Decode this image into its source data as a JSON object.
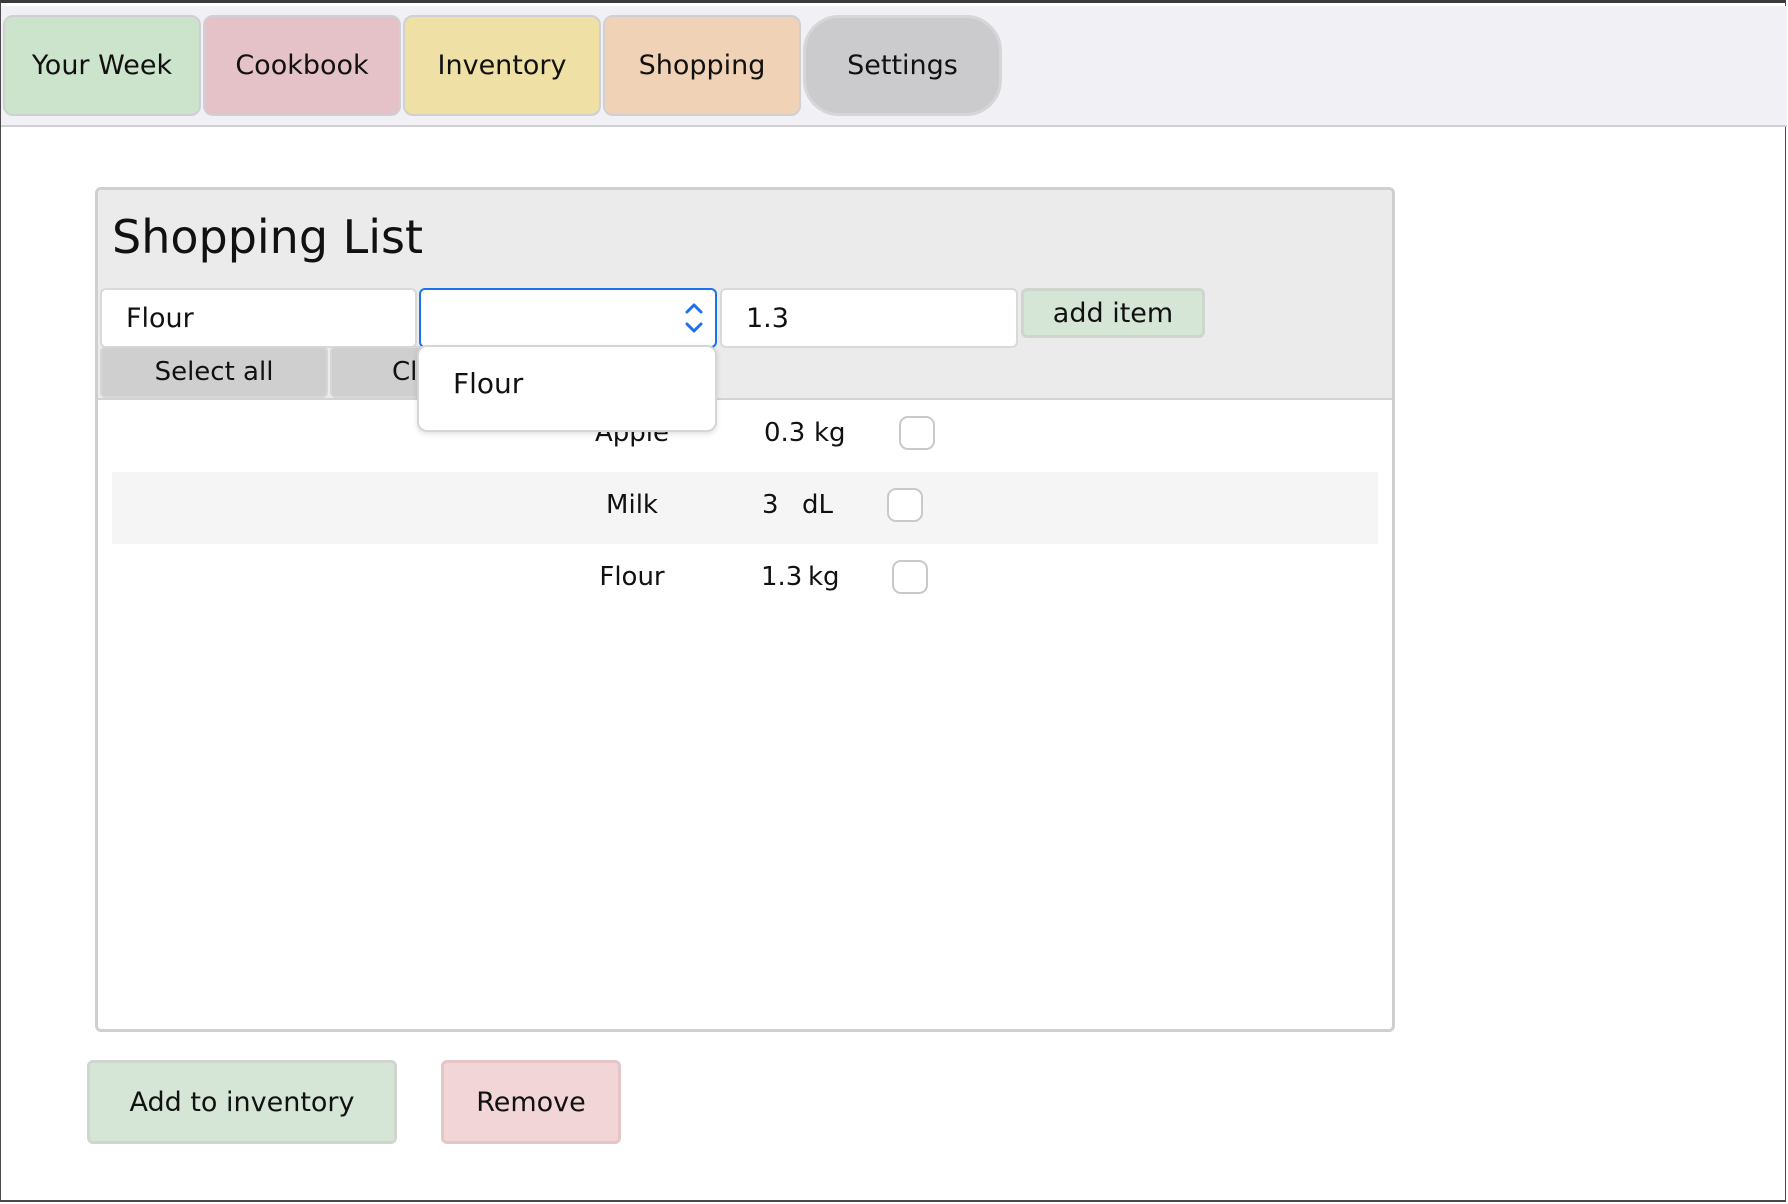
{
  "nav": {
    "tabs": [
      {
        "label": "Your Week",
        "color": "#cce3cc"
      },
      {
        "label": "Cookbook",
        "color": "#e4c2c8"
      },
      {
        "label": "Inventory",
        "color": "#efe0a6"
      },
      {
        "label": "Shopping",
        "color": "#f0d3b7"
      },
      {
        "label": "Settings",
        "color": "#cbcbcd"
      }
    ]
  },
  "shopping": {
    "title": "Shopping List",
    "form": {
      "name_value": "Flour",
      "unit_value": "",
      "quantity_value": "1.3",
      "add_item_label": "add item",
      "unit_options_visible": [
        "Flour"
      ]
    },
    "controls": {
      "select_all_label": "Select all",
      "clear_label_visible": "Cl"
    },
    "items": [
      {
        "name": "Apple",
        "quantity": "0.3",
        "unit": "kg",
        "checked": false
      },
      {
        "name": "Milk",
        "quantity": "3",
        "unit": "dL",
        "checked": false
      },
      {
        "name": "Flour",
        "quantity": "1.3",
        "unit": "kg",
        "checked": false
      }
    ],
    "actions": {
      "add_to_inventory_label": "Add to inventory",
      "remove_label": "Remove"
    }
  },
  "colors": {
    "accent_blue": "#1a73e8",
    "add_green": "#d6e6d6",
    "remove_pink": "#f1d5d7"
  }
}
